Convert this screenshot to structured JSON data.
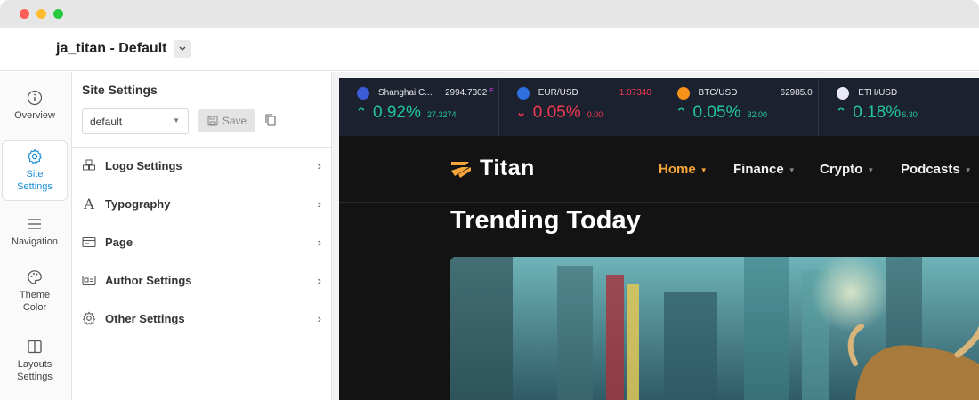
{
  "window": {
    "controls": [
      "close",
      "minimize",
      "maximize"
    ]
  },
  "header": {
    "template_title": "ja_titan - Default",
    "dropdown_icon": "chevron-down-icon"
  },
  "rail": {
    "items": [
      {
        "label": "Overview",
        "icon": "info-icon",
        "active": false
      },
      {
        "label": "Site Settings",
        "icon": "gear-icon",
        "active": true
      },
      {
        "label": "Navigation",
        "icon": "hamburger-icon",
        "active": false
      },
      {
        "label": "Theme Color",
        "icon": "palette-icon",
        "active": false
      },
      {
        "label": "Layouts Settings",
        "icon": "columns-icon",
        "active": false
      }
    ]
  },
  "panel": {
    "title": "Site Settings",
    "preset_value": "default",
    "save_label": "Save",
    "menu": [
      {
        "label": "Logo Settings",
        "icon": "cubes-icon"
      },
      {
        "label": "Typography",
        "icon": "font-icon"
      },
      {
        "label": "Page",
        "icon": "card-icon"
      },
      {
        "label": "Author Settings",
        "icon": "id-card-icon"
      },
      {
        "label": "Other Settings",
        "icon": "gear-icon"
      }
    ]
  },
  "preview": {
    "ticker": [
      {
        "symbol": "Shanghai C...",
        "price": "2994.7302",
        "price_suffix": "E",
        "direction": "up",
        "percent": "0.92%",
        "change": "27.3274"
      },
      {
        "symbol": "EUR/USD",
        "price": "1.07340",
        "direction": "down",
        "percent": "0.05%",
        "change": "0.00"
      },
      {
        "symbol": "BTC/USD",
        "price": "62985.0",
        "direction": "up",
        "percent": "0.05%",
        "change": "32.00"
      },
      {
        "symbol": "ETH/USD",
        "price": "",
        "direction": "up",
        "percent": "0.18%",
        "change": "6.30"
      }
    ],
    "logo_text": "Titan",
    "nav": [
      "Home",
      "Finance",
      "Crypto",
      "Podcasts"
    ],
    "heading": "Trending Today"
  },
  "colors": {
    "accent": "#1a8cd8",
    "nav_active": "#f6a53a",
    "up": "#21c79a",
    "down": "#ef3a4e"
  }
}
